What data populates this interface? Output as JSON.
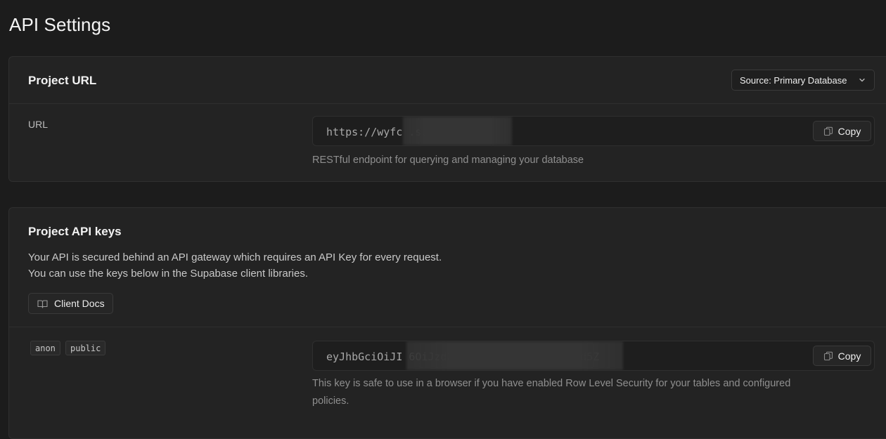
{
  "page": {
    "title": "API Settings"
  },
  "project_url": {
    "title": "Project URL",
    "source_select": {
      "label": "Source: Primary Database"
    },
    "url_label": "URL",
    "url_value": "https://wyfc                 .supabase.co",
    "copy_label": "Copy",
    "helper": "RESTful endpoint for querying and managing your database"
  },
  "api_keys": {
    "title": "Project API keys",
    "description_line1": "Your API is secured behind an API gateway which requires an API Key for every request.",
    "description_line2": "You can use the keys below in the Supabase client libraries.",
    "client_docs_label": "Client Docs",
    "tags": [
      "anon",
      "public"
    ],
    "key_value": "eyJhbGciOiJI                                    6OiJzdXBhYmFzZSIsInJlZiI6Ind5Z",
    "copy_label": "Copy",
    "helper_line1": "This key is safe to use in a browser if you have enabled Row Level Security for your tables and configured",
    "helper_line2": "policies."
  },
  "colors": {
    "background": "#1c1c1c",
    "panel": "#232323",
    "border": "#2f2f2f",
    "muted_text": "#8f8f8f"
  }
}
